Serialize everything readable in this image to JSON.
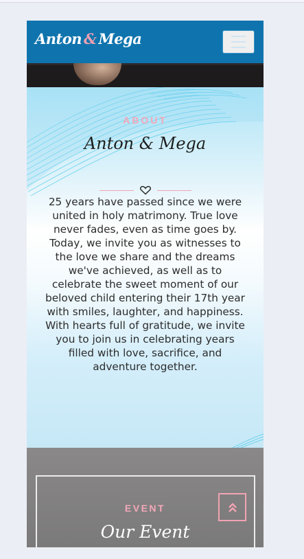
{
  "navbar": {
    "brand_first": "Anton",
    "brand_amp": "&",
    "brand_second": "Mega",
    "menu_icon": "hamburger-icon"
  },
  "about": {
    "eyebrow": "ABOUT",
    "title": "Anton & Mega",
    "divider_icon": "heart-icon",
    "paragraphs": [
      "25 years have passed since we were united in holy matrimony. True love never fades, even as time goes by.",
      "Today, we invite you as witnesses to the love we share and the dreams we've achieved, as well as to celebrate the sweet moment of our beloved child entering their 17th year with smiles, laughter, and happiness.",
      "With hearts full of gratitude, we invite you to join us in celebrating years filled with love, sacrifice, and adventure together."
    ]
  },
  "event": {
    "eyebrow": "EVENT",
    "title": "Our Event",
    "scroll_icon": "double-chevron-up-icon"
  },
  "colors": {
    "navbar": "#0f74ad",
    "accent_pink": "#f3a7b9",
    "about_bg": "#c6e8f6",
    "event_bg": "#7b7a7a"
  }
}
